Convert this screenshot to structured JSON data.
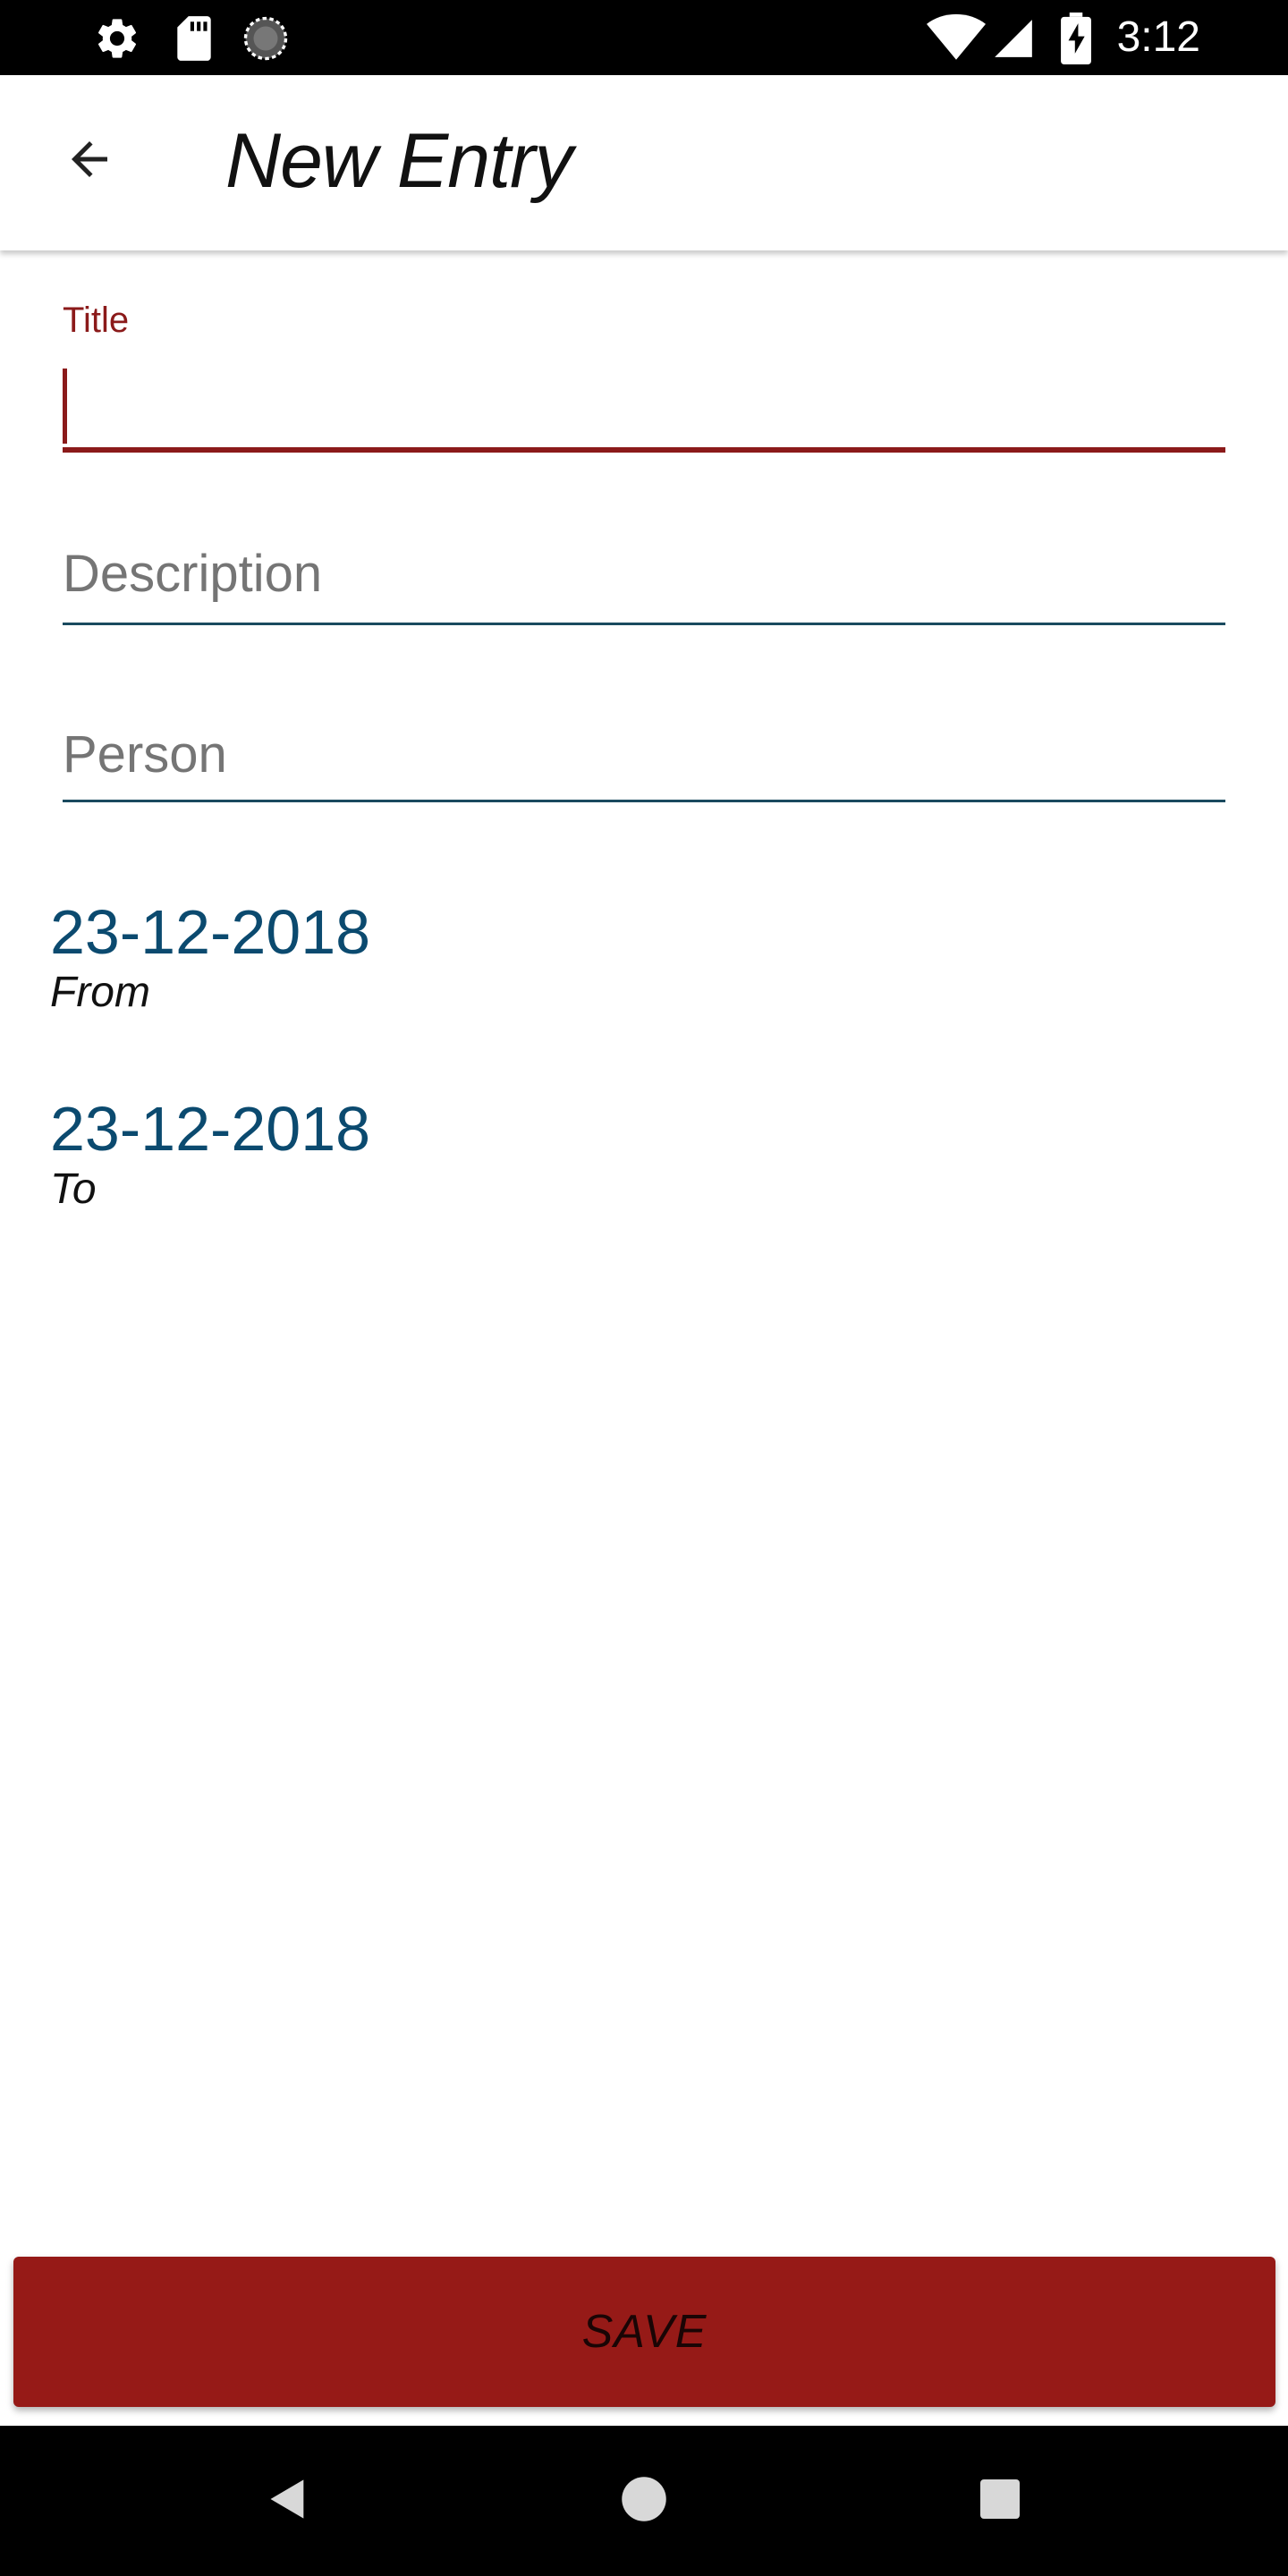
{
  "status_bar": {
    "time": "3:12",
    "icons": [
      "settings-icon",
      "sd-card-icon",
      "loading-icon",
      "wifi-icon",
      "signal-icon",
      "battery-charging-icon"
    ]
  },
  "app_bar": {
    "title": "New Entry",
    "back_icon": "arrow-back-icon"
  },
  "form": {
    "title_field": {
      "label": "Title",
      "value": ""
    },
    "description_field": {
      "placeholder": "Description",
      "value": ""
    },
    "person_field": {
      "placeholder": "Person",
      "value": ""
    }
  },
  "dates": {
    "from": {
      "value": "23-12-2018",
      "caption": "From"
    },
    "to": {
      "value": "23-12-2018",
      "caption": "To"
    }
  },
  "save_button": {
    "label": "SAVE"
  },
  "colors": {
    "accent": "#8b1a1a",
    "button": "#961a17",
    "date_text": "#0b4a6f",
    "underline": "#1a4a5f"
  },
  "nav_bar": {
    "icons": [
      "back-triangle-icon",
      "home-circle-icon",
      "recents-square-icon"
    ]
  }
}
